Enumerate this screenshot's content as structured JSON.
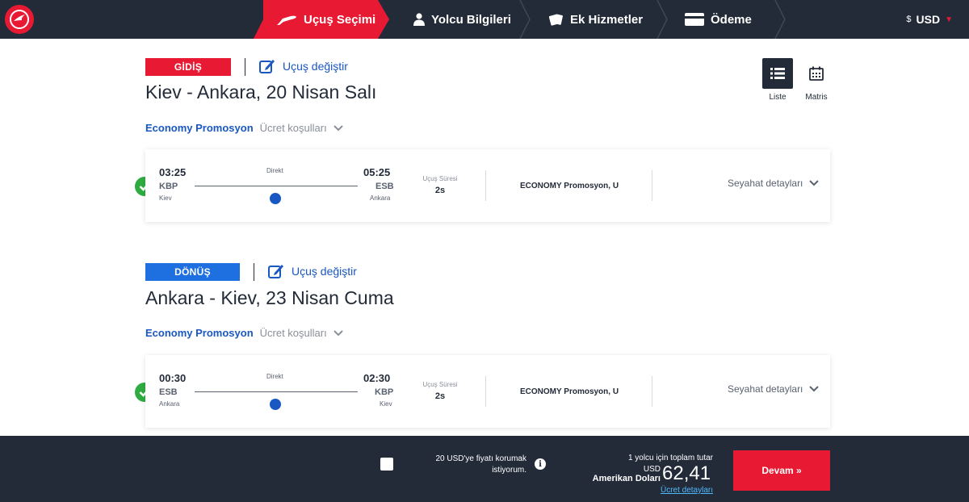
{
  "nav": {
    "steps": [
      {
        "label": "Uçuş Seçimi",
        "icon": "plane-icon",
        "active": true
      },
      {
        "label": "Yolcu Bilgileri",
        "icon": "person-icon",
        "active": false
      },
      {
        "label": "Ek Hizmetler",
        "icon": "tickets-icon",
        "active": false
      },
      {
        "label": "Ödeme",
        "icon": "credit-card-icon",
        "active": false
      }
    ],
    "currency_symbol": "$",
    "currency": "USD"
  },
  "colors": {
    "brand_red": "#e81932",
    "navy": "#232b38",
    "blue": "#1957c2",
    "return_blue": "#1e6fe0",
    "green": "#2fac41"
  },
  "view_toggle": {
    "list_label": "Liste",
    "matrix_label": "Matris"
  },
  "outbound": {
    "badge": "GİDİŞ",
    "change_label": "Uçuş değiştir",
    "title": "Kiev - Ankara, 20 Nisan Salı",
    "fare_brand": "Economy Promosyon",
    "fare_conditions": "Ücret koşulları",
    "flight": {
      "dep_time": "03:25",
      "dep_code": "KBP",
      "dep_city": "Kiev",
      "type": "Direkt",
      "arr_time": "05:25",
      "arr_code": "ESB",
      "arr_city": "Ankara",
      "duration_label": "Uçuş Süresi",
      "duration": "2s",
      "cabin": "ECONOMY Promosyon, U",
      "details_label": "Seyahat detayları"
    }
  },
  "return": {
    "badge": "DÖNÜŞ",
    "change_label": "Uçuş değiştir",
    "title": "Ankara - Kiev, 23 Nisan Cuma",
    "fare_brand": "Economy Promosyon",
    "fare_conditions": "Ücret koşulları",
    "flight": {
      "dep_time": "00:30",
      "dep_code": "ESB",
      "dep_city": "Ankara",
      "type": "Direkt",
      "arr_time": "02:30",
      "arr_code": "KBP",
      "arr_city": "Kiev",
      "duration_label": "Uçuş Süresi",
      "duration": "2s",
      "cabin": "ECONOMY Promosyon, U",
      "details_label": "Seyahat detayları"
    }
  },
  "bottom": {
    "protect_text": "20 USD'ye fiyatı korumak istiyorum.",
    "total_label": "1 yolcu için toplam tutar",
    "currency_code": "USD",
    "currency_name": "Amerikan Doları",
    "amount": "62,41",
    "fare_details": "Ücret detayları",
    "continue": "Devam »"
  }
}
